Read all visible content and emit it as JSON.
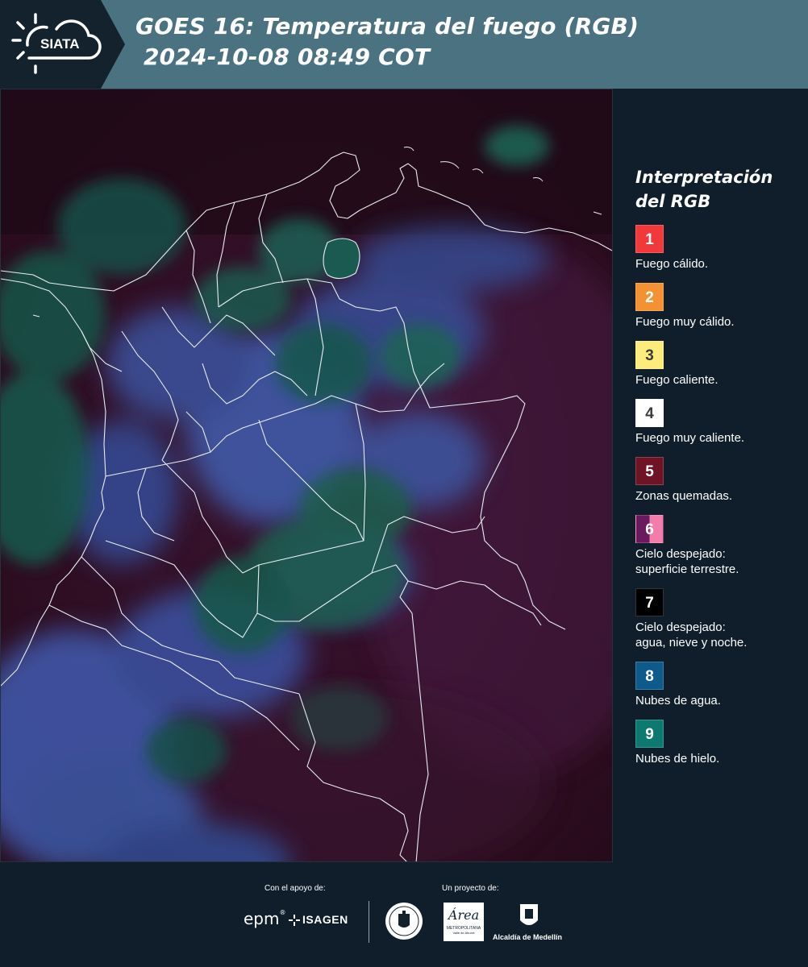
{
  "header": {
    "logo_text": "SIATA",
    "title_line1": "GOES 16: Temperatura del fuego (RGB)",
    "title_line2": "2024-10-08 08:49 COT"
  },
  "legend": {
    "title_line1": "Interpretación",
    "title_line2": "del RGB",
    "items": [
      {
        "num": "1",
        "label": "Fuego cálido.",
        "color": "#f2383b",
        "text_color": "#ffffff"
      },
      {
        "num": "2",
        "label": "Fuego muy cálido.",
        "color": "#f39133",
        "text_color": "#ffffff"
      },
      {
        "num": "3",
        "label": "Fuego caliente.",
        "color": "#fcec7b",
        "text_color": "#3a3a3a"
      },
      {
        "num": "4",
        "label": "Fuego muy caliente.",
        "color": "#ffffff",
        "text_color": "#3a3a3a"
      },
      {
        "num": "5",
        "label": "Zonas quemadas.",
        "color": "#6e1426",
        "text_color": "#ffffff"
      },
      {
        "num": "6",
        "label": "Cielo despejado: superficie terrestre.",
        "color": "#6a1a5e",
        "color2": "#f47caa",
        "text_color": "#ffffff"
      },
      {
        "num": "7",
        "label": "Cielo despejado: agua, nieve y noche.",
        "color": "#000000",
        "text_color": "#ffffff"
      },
      {
        "num": "8",
        "label": "Nubes de agua.",
        "color": "#0e5b8b",
        "text_color": "#ffffff"
      },
      {
        "num": "9",
        "label": "Nubes de hielo.",
        "color": "#0d7a72",
        "text_color": "#ffffff"
      }
    ]
  },
  "footer": {
    "support_label": "Con el apoyo de:",
    "project_label": "Un proyecto de:",
    "epm": "epm",
    "isagen": "ISAGEN",
    "area_name": "Área",
    "area_sub": "METROPOLITANA",
    "area_sub2": "Valle de Aburrá",
    "alcaldia": "Alcaldía de Medellín"
  },
  "colors": {
    "background": "#0f1e2a",
    "header": "#4a7281",
    "map_base": "#2a0d1e"
  }
}
